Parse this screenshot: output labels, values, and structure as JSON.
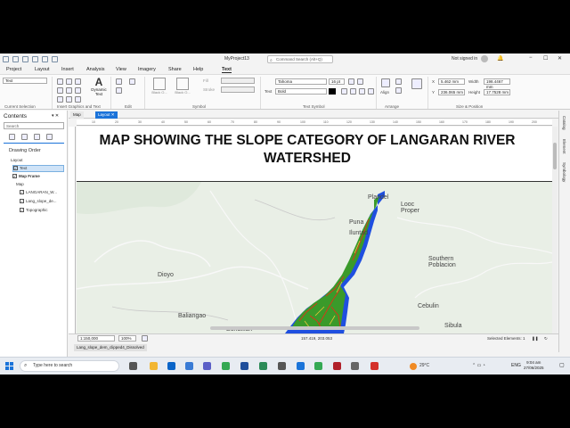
{
  "titlebar": {
    "project": "MyProject13",
    "search_placeholder": "Command Search (Alt+Q)",
    "signin": "Not signed in",
    "minimize": "−",
    "maximize": "☐",
    "close": "✕"
  },
  "ribbon_tabs": [
    "Project",
    "Layout",
    "Insert",
    "Analysis",
    "View",
    "Imagery",
    "Share",
    "Help",
    "Text"
  ],
  "active_tab": "Text",
  "ribbon": {
    "selection_box": "Text",
    "groups": {
      "current_selection": "Current Selection",
      "insert_graphics": "Insert Graphics and Text",
      "edit": "Edit",
      "symbol": "Symbol",
      "text_symbol": "Text Symbol",
      "arrange": "Arrange",
      "size_position": "Size & Position"
    },
    "dynamic_text": "Dynamic\nText",
    "symbol_labels": {
      "black_outline": "Black O...",
      "black_outline2": "Black O...",
      "fill": "Fill",
      "stroke": "Stroke"
    },
    "text_symbol": {
      "font": "Tahoma",
      "size": "16 pt",
      "style": "Bold",
      "text_label": "Text"
    },
    "arrange_label": "Align",
    "size_position": {
      "x_label": "X",
      "x": "5.462 mm",
      "y_label": "Y",
      "y": "236.065 mm",
      "width_label": "Width",
      "width": "198.4467 mm",
      "height_label": "Height",
      "height": "17.7528 mm"
    }
  },
  "contents": {
    "title": "Contents",
    "search_placeholder": "Search",
    "drawing_order": "Drawing Order",
    "items": [
      "Layout",
      "Text",
      "Map Frame",
      "Map",
      "LANGARAN_W...",
      "Lang_slope_de...",
      "Topographic"
    ]
  },
  "doc_tabs": [
    "Map",
    "Layout"
  ],
  "ruler_labels": [
    "10",
    "20",
    "30",
    "40",
    "50",
    "60",
    "70",
    "80",
    "90",
    "100",
    "110",
    "120",
    "130",
    "140",
    "150",
    "160",
    "170",
    "180",
    "190",
    "200"
  ],
  "map": {
    "title": "MAP SHOWING THE SLOPE CATEGORY OF LANGARAN RIVER WATERSHED",
    "places": [
      "Plaridel",
      "Puna",
      "Iluntad",
      "Looc Proper",
      "Dioyo",
      "Southern Poblacion",
      "Baliangao",
      "Bunawan",
      "Cebulin",
      "Sibula"
    ],
    "colors": {
      "watershed_outline": "#1f4fe0",
      "slope_green": "#3a9a2a",
      "slope_red": "#d23a1a",
      "slope_yellow": "#e8c73a",
      "basemap": "#e9efe6"
    }
  },
  "statusbar": {
    "scale": "1:150,000",
    "zoom": "100%",
    "coords": "157.419, 203.053",
    "selected": "Selected Elements: 1"
  },
  "bottom_tab": "Lang_slope_dem_clipped4_Dissolved",
  "side_tabs": [
    "Catalog",
    "Element",
    "Symbology"
  ],
  "taskbar": {
    "search": "Type here to search",
    "weather": "29°C",
    "lang": "ENG",
    "time": "9:04 am",
    "date": "27/06/2025"
  }
}
